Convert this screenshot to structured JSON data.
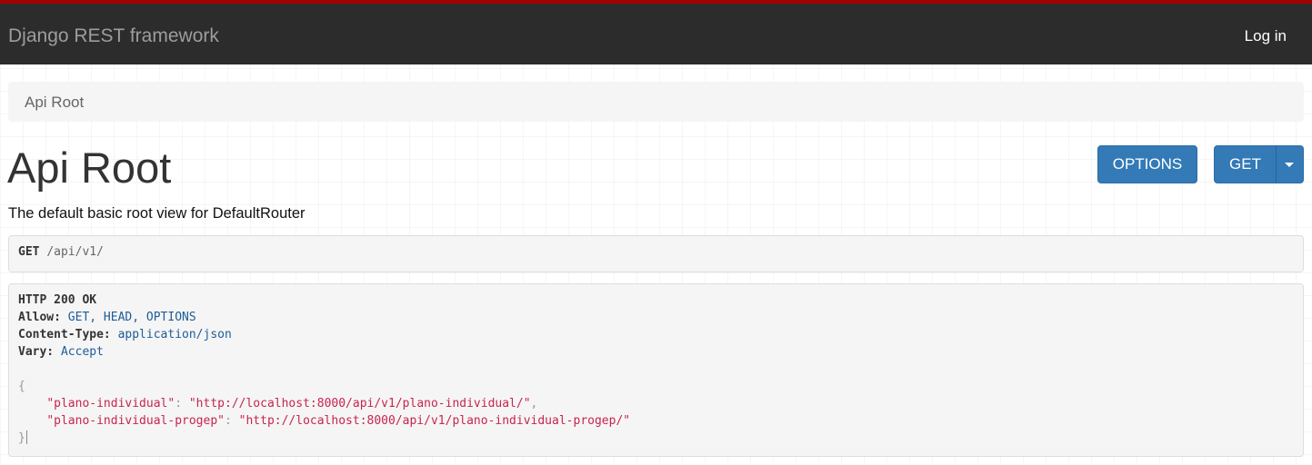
{
  "navbar": {
    "brand": "Django REST framework",
    "login_label": "Log in"
  },
  "breadcrumb": {
    "items": [
      "Api Root"
    ]
  },
  "page": {
    "title": "Api Root",
    "description": "The default basic root view for DefaultRouter"
  },
  "buttons": {
    "options_label": "OPTIONS",
    "get_label": "GET"
  },
  "request": {
    "method": "GET",
    "path": "/api/v1/"
  },
  "response": {
    "status_line": "HTTP 200 OK",
    "headers": [
      {
        "name": "Allow:",
        "value": "GET, HEAD, OPTIONS"
      },
      {
        "name": "Content-Type:",
        "value": "application/json"
      },
      {
        "name": "Vary:",
        "value": "Accept"
      }
    ],
    "body_open": "{",
    "body_close": "}",
    "entries": [
      {
        "key": "\"plano-individual\"",
        "value": "\"http://localhost:8000/api/v1/plano-individual/\"",
        "trailing": ","
      },
      {
        "key": "\"plano-individual-progep\"",
        "value": "\"http://localhost:8000/api/v1/plano-individual-progep/\"",
        "trailing": ""
      }
    ]
  },
  "colors": {
    "navbar_bg": "#2c2c2c",
    "navbar_accent": "#a30000",
    "button_primary": "#337ab7",
    "json_string": "#c7254e",
    "header_value": "#1e5c97"
  }
}
